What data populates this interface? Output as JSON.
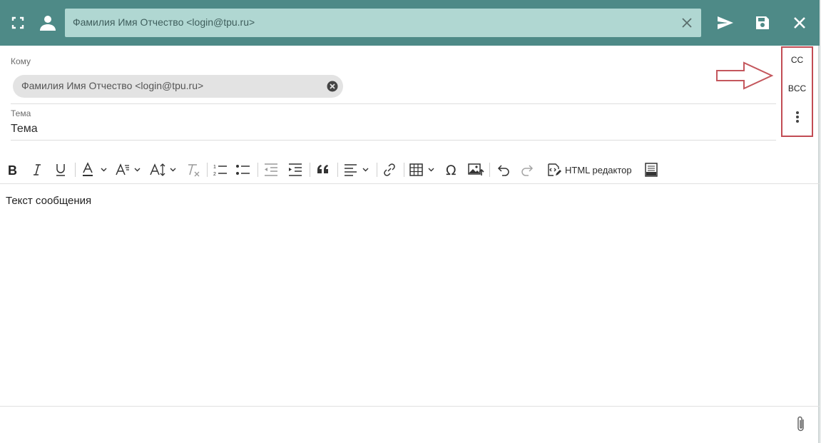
{
  "header": {
    "expand_icon": "fullscreen-icon",
    "contact_icon": "person-icon",
    "from_value": "Фамилия Имя Отчество <login@tpu.ru>",
    "clear_icon": "close-icon",
    "send_icon": "send-icon",
    "save_icon": "floppy-disk-icon",
    "close_icon": "close-icon",
    "color": "#4e8a87",
    "field_color": "#b0d7d2"
  },
  "recipients": {
    "to_label": "Кому",
    "to_chip": "Фамилия Имя Отчество <login@tpu.ru>",
    "chip_remove_icon": "remove-circle-icon",
    "cc_label": "CC",
    "bcc_label": "BCC",
    "more_icon": "vertical-dots-icon",
    "highlight_color": "#c24c54"
  },
  "subject": {
    "label": "Тема",
    "value": "Тема"
  },
  "toolbar": {
    "items": [
      "bold",
      "italic",
      "underline",
      "font-color",
      "font-family",
      "font-size",
      "remove-format",
      "numbered-list",
      "bulleted-list",
      "outdent",
      "indent",
      "block-quote",
      "alignment",
      "link",
      "table",
      "special-characters",
      "insert-image",
      "undo",
      "redo",
      "html-editor",
      "source"
    ],
    "html_editor_label": "HTML редактор"
  },
  "editor": {
    "body": "Текст сообщения"
  },
  "footer": {
    "attach_icon": "paperclip-icon"
  }
}
